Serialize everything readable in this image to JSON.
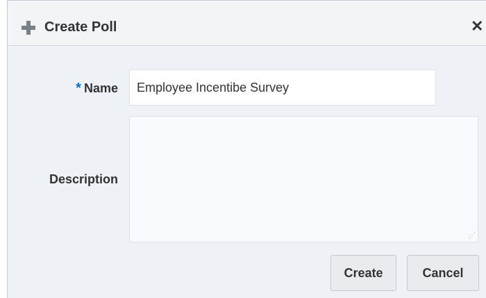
{
  "dialog": {
    "title": "Create Poll",
    "close_glyph": "✕"
  },
  "form": {
    "name": {
      "required_marker": "*",
      "label": "Name",
      "value": "Employee Incentibe Survey"
    },
    "description": {
      "label": "Description",
      "value": ""
    }
  },
  "buttons": {
    "create_label": "Create",
    "cancel_label": "Cancel"
  },
  "icons": {
    "title_icon": "plus-icon",
    "close_icon": "close-icon",
    "resize_icon": "resize-handle-icon"
  },
  "colors": {
    "required_accent": "#0572ce",
    "titlebar_bg": "#f3f4f6",
    "body_bg": "#eef2f6"
  }
}
